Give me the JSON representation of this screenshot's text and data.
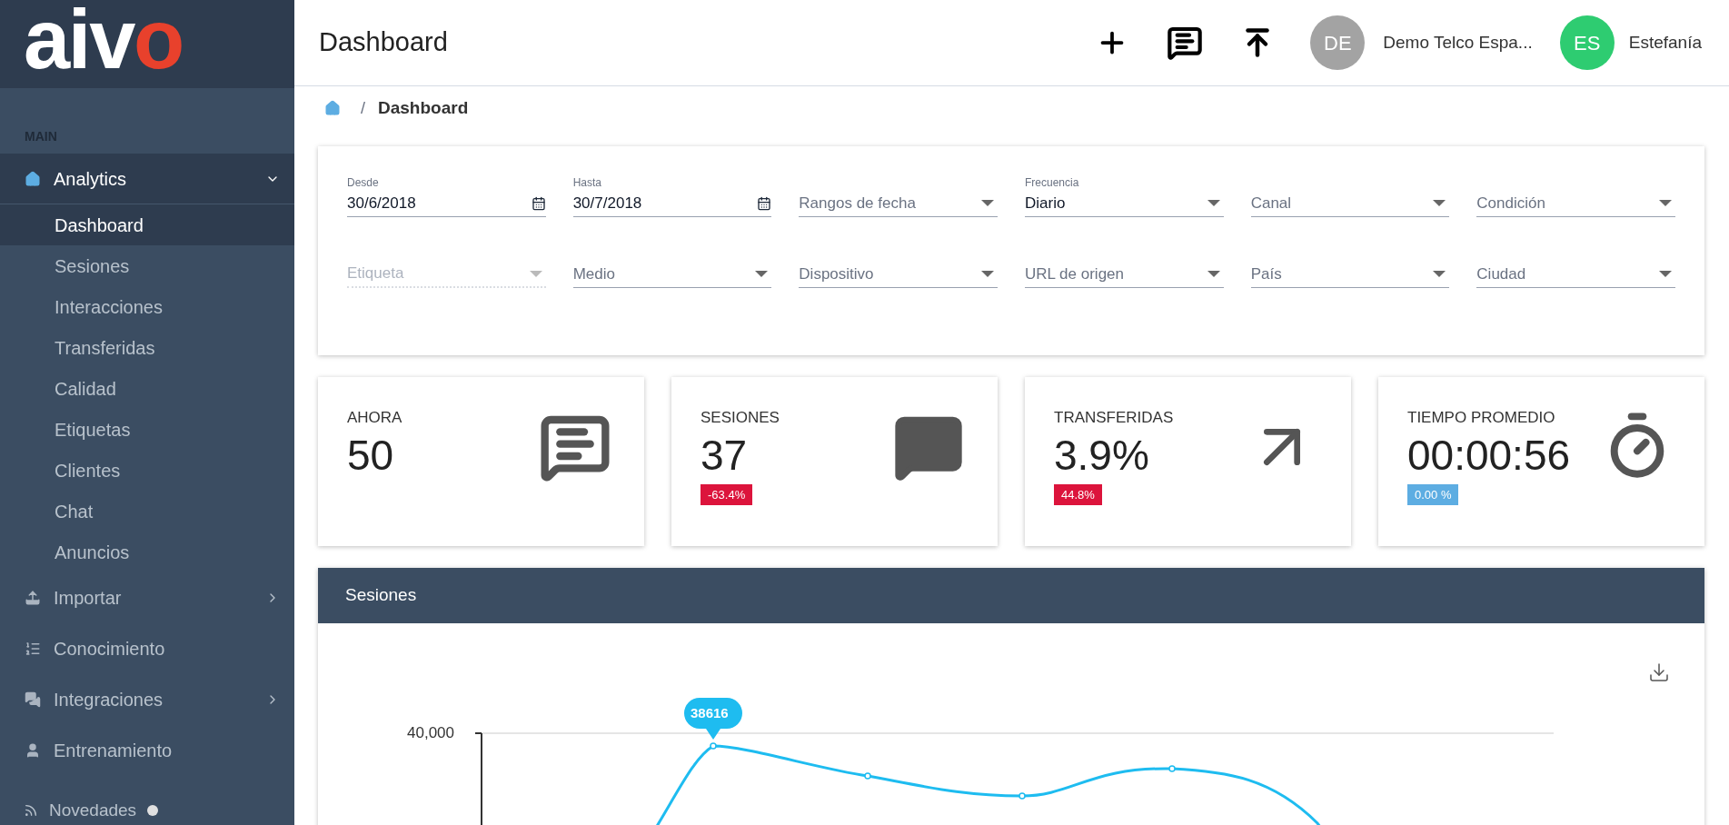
{
  "logo": {
    "text_left": "aiv",
    "text_right": "o"
  },
  "sidebar": {
    "section": "MAIN",
    "items": [
      {
        "label": "Analytics",
        "expanded": true,
        "has_arrow": true,
        "children": [
          {
            "label": "Dashboard",
            "selected": true
          },
          {
            "label": "Sesiones",
            "selected": false
          },
          {
            "label": "Interacciones",
            "selected": false
          },
          {
            "label": "Transferidas",
            "selected": false
          },
          {
            "label": "Calidad",
            "selected": false
          },
          {
            "label": "Etiquetas",
            "selected": false
          },
          {
            "label": "Clientes",
            "selected": false
          },
          {
            "label": "Chat",
            "selected": false
          },
          {
            "label": "Anuncios",
            "selected": false
          }
        ]
      },
      {
        "label": "Importar",
        "expanded": false,
        "has_arrow": true
      },
      {
        "label": "Conocimiento",
        "expanded": false,
        "has_arrow": false
      },
      {
        "label": "Integraciones",
        "expanded": false,
        "has_arrow": true
      },
      {
        "label": "Entrenamiento",
        "expanded": false,
        "has_arrow": false
      }
    ],
    "footer": {
      "label": "Novedades"
    }
  },
  "topbar": {
    "title": "Dashboard",
    "account": {
      "initials": "DE",
      "name": "Demo Telco Espa..."
    },
    "user": {
      "initials": "ES",
      "name": "Estefanía"
    }
  },
  "breadcrumb": {
    "separator": "/",
    "current": "Dashboard"
  },
  "filters": [
    {
      "kind": "date",
      "label": "Desde",
      "value": "30/6/2018",
      "disabled": false
    },
    {
      "kind": "date",
      "label": "Hasta",
      "value": "30/7/2018",
      "disabled": false
    },
    {
      "kind": "select",
      "placeholder": "Rangos de fecha",
      "disabled": false
    },
    {
      "kind": "select",
      "label": "Frecuencia",
      "value": "Diario",
      "disabled": false
    },
    {
      "kind": "select",
      "placeholder": "Canal",
      "disabled": false
    },
    {
      "kind": "select",
      "placeholder": "Condición",
      "disabled": false
    },
    {
      "kind": "select",
      "placeholder": "Etiqueta",
      "disabled": true
    },
    {
      "kind": "select",
      "placeholder": "Medio",
      "disabled": false
    },
    {
      "kind": "select",
      "placeholder": "Dispositivo",
      "disabled": false
    },
    {
      "kind": "select",
      "placeholder": "URL de origen",
      "disabled": false
    },
    {
      "kind": "select",
      "placeholder": "País",
      "disabled": false
    },
    {
      "kind": "select",
      "placeholder": "Ciudad",
      "disabled": false
    }
  ],
  "stats": [
    {
      "title": "AHORA",
      "value": "50"
    },
    {
      "title": "SESIONES",
      "value": "37",
      "change": "-63.4%",
      "color": "#dc143c"
    },
    {
      "title": "TRANSFERIDAS",
      "value": "3.9%",
      "change": "44.8%",
      "color": "#dc143c"
    },
    {
      "title": "TIEMPO PROMEDIO",
      "value": "00:00:56",
      "change": "0.00 %",
      "color": "#5dade2"
    }
  ],
  "chart_panel": {
    "title": "Sesiones",
    "tick_label": "40,000",
    "peak_label": "38616"
  }
}
